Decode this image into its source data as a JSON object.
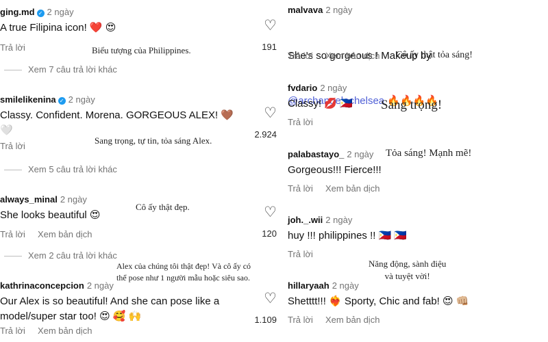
{
  "labels": {
    "reply": "Trả lời",
    "translate": "Xem bản dịch",
    "heart_glyph": "♡",
    "verified_glyph": "✓"
  },
  "left": [
    {
      "user": "ging.md",
      "verified": true,
      "time": "2 ngày",
      "text": "A true Filipina icon! ❤️ 😍",
      "likes": "191",
      "annotation": "Biểu tượng của Philippines.",
      "replies": "Xem 7 câu trả lời khác"
    },
    {
      "user": "smilelikenina",
      "verified": true,
      "time": "2 ngày",
      "text": "Classy. Confident. Morena. GORGEOUS ALEX! 🤎\n🤍",
      "likes": "2.924",
      "annotation": "Sang trọng, tự tin, tỏa sáng Alex.",
      "replies": "Xem 5 câu trả lời khác"
    },
    {
      "user": "always_minal",
      "verified": false,
      "time": "2 ngày",
      "text": "She looks beautiful 😍",
      "likes": "120",
      "annotation": "Cô ấy thật đẹp.",
      "replies": "Xem 2 câu trả lời khác"
    },
    {
      "user": "kathrinaconcepcion",
      "verified": false,
      "time": "2 ngày",
      "text": "Our Alex is so beautiful! And she can pose like a\nmodel/super star too! 😍 🥰 🙌",
      "likes": "1.109",
      "annotation_line1": "Alex của chúng tôi thật đẹp! Và cô ấy có",
      "annotation_line2": "thể pose như 1 người mẫu hoặc siêu sao."
    }
  ],
  "right": [
    {
      "user": "malvava",
      "time": "2 ngày",
      "text_line1": "She's so gorgeous ! Makeup by",
      "mention": "@archangelachelsea",
      "fire": "🔥🔥🔥🔥",
      "annotation": "Cô ấy thật tỏa sáng!"
    },
    {
      "user": "fvdario",
      "time": "2 ngày",
      "text": "Classy! 💋 🇵🇭",
      "annotation": "Sang trọng!"
    },
    {
      "user": "palabastayo_",
      "time": "2 ngày",
      "text": "Gorgeous!!! Fierce!!!",
      "annotation": "Tỏa sáng! Mạnh mẽ!"
    },
    {
      "user": "joh._.wii",
      "time": "2 ngày",
      "text": "huy !!! philippines !! 🇵🇭 🇵🇭",
      "annotation_line1": "Năng động, sành điệu",
      "annotation_line2": "và tuyệt vời!"
    },
    {
      "user": "hillaryaah",
      "time": "2 ngày",
      "text": "Shetttt!!! ❤️‍🔥 Sporty, Chic and fab! 😍 👊🏼"
    }
  ]
}
